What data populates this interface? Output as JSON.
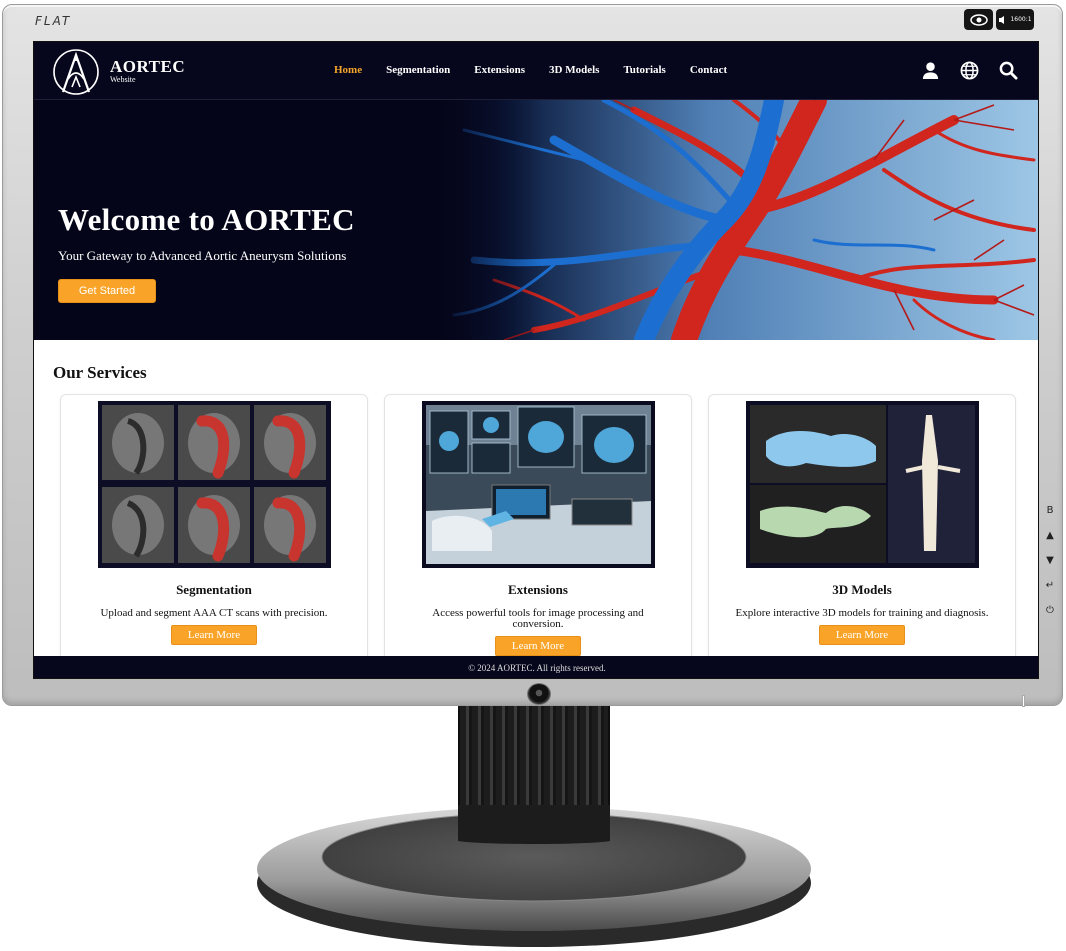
{
  "monitor": {
    "brand": "FLAT",
    "resolution_badge": "1600:1",
    "side_controls": [
      "B",
      "▲",
      "▼",
      "↵",
      "⏻"
    ]
  },
  "site": {
    "logo": {
      "title": "AORTEC",
      "subtitle": "Website"
    },
    "nav": {
      "items": [
        {
          "label": "Home",
          "active": true
        },
        {
          "label": "Segmentation",
          "active": false
        },
        {
          "label": "Extensions",
          "active": false
        },
        {
          "label": "3D Models",
          "active": false
        },
        {
          "label": "Tutorials",
          "active": false
        },
        {
          "label": "Contact",
          "active": false
        }
      ],
      "icons": [
        "user-icon",
        "globe-icon",
        "search-icon"
      ]
    },
    "hero": {
      "title": "Welcome to AORTEC",
      "subtitle": "Your Gateway to Advanced Aortic Aneurysm Solutions",
      "cta": "Get Started"
    },
    "services": {
      "heading": "Our Services",
      "cards": [
        {
          "title": "Segmentation",
          "description": "Upload and segment AAA CT scans with precision.",
          "button": "Learn More"
        },
        {
          "title": "Extensions",
          "description": "Access powerful tools for image processing and conversion.",
          "button": "Learn More"
        },
        {
          "title": "3D Models",
          "description": "Explore interactive 3D models for training and diagnosis.",
          "button": "Learn More"
        }
      ]
    },
    "footer": "© 2024 AORTEC. All rights reserved."
  },
  "colors": {
    "nav_bg": "#06061c",
    "accent": "#f9a428",
    "active_link": "#f4a52a"
  }
}
